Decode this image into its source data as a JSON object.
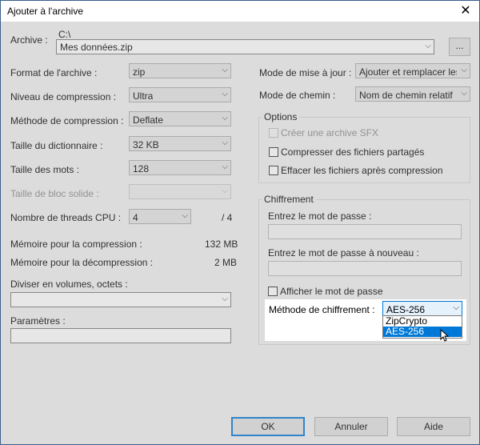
{
  "window": {
    "title": "Ajouter à l'archive",
    "close_glyph": "✕"
  },
  "archive": {
    "label": "Archive :",
    "path": "C:\\",
    "filename": "Mes données.zip",
    "browse_label": "..."
  },
  "left": {
    "format": {
      "label": "Format de l'archive :",
      "value": "zip"
    },
    "level": {
      "label": "Niveau de compression :",
      "value": "Ultra"
    },
    "method": {
      "label": "Méthode de compression :",
      "value": "Deflate"
    },
    "dict": {
      "label": "Taille du dictionnaire :",
      "value": "32 KB"
    },
    "word": {
      "label": "Taille des mots :",
      "value": "128"
    },
    "solid": {
      "label": "Taille de bloc solide :",
      "value": ""
    },
    "threads": {
      "label": "Nombre de threads CPU :",
      "value": "4",
      "max": "/ 4"
    },
    "mem_comp": {
      "label": "Mémoire pour la compression :",
      "value": "132 MB"
    },
    "mem_decomp": {
      "label": "Mémoire pour la décompression :",
      "value": "2 MB"
    },
    "split": {
      "label": "Diviser en volumes, octets :",
      "value": ""
    },
    "params": {
      "label": "Paramètres :",
      "value": ""
    }
  },
  "right": {
    "update_mode": {
      "label": "Mode de mise à jour :",
      "value": "Ajouter et remplacer les fichiers"
    },
    "path_mode": {
      "label": "Mode de chemin :",
      "value": "Nom de chemin relatif"
    },
    "options": {
      "title": "Options",
      "sfx": "Créer une archive SFX",
      "shared": "Compresser des fichiers partagés",
      "delete": "Effacer les fichiers après compression"
    },
    "encryption": {
      "title": "Chiffrement",
      "pwd_label": "Entrez le mot de passe :",
      "pwd_value": "",
      "pwd2_label": "Entrez le mot de passe à nouveau :",
      "pwd2_value": "",
      "show_label": "Afficher le mot de passe",
      "method_label": "Méthode de chiffrement :",
      "method_value": "AES-256",
      "options": [
        "ZipCrypto",
        "AES-256"
      ]
    }
  },
  "buttons": {
    "ok": "OK",
    "cancel": "Annuler",
    "help": "Aide"
  },
  "colors": {
    "accent": "#0078d7",
    "window_border": "#3a5f8a"
  },
  "icons": {
    "dropdown": "chevron-down-icon",
    "close": "close-icon",
    "cursor": "mouse-pointer-icon"
  }
}
